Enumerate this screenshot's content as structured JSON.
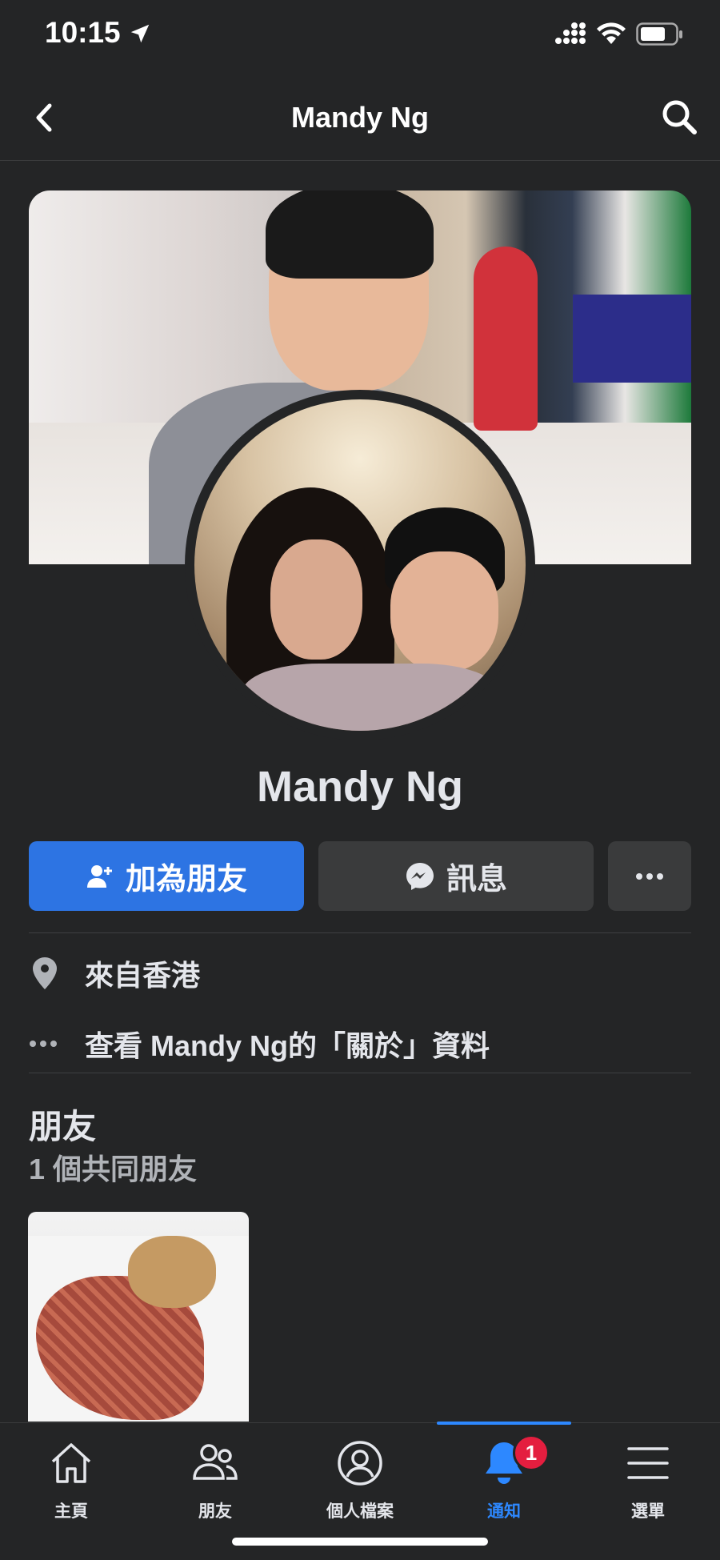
{
  "status": {
    "time": "10:15"
  },
  "nav": {
    "title": "Mandy Ng"
  },
  "profile": {
    "name": "Mandy Ng"
  },
  "actions": {
    "add_friend": "加為朋友",
    "message": "訊息"
  },
  "info": {
    "from": "來自香港",
    "about_link": "查看 Mandy Ng的「關於」資料"
  },
  "friends": {
    "title": "朋友",
    "mutual": "1 個共同朋友"
  },
  "tabbar": {
    "items": [
      {
        "label": "主頁",
        "icon": "home-icon"
      },
      {
        "label": "朋友",
        "icon": "friends-icon"
      },
      {
        "label": "個人檔案",
        "icon": "profile-icon"
      },
      {
        "label": "通知",
        "icon": "bell-icon",
        "active": true,
        "badge": "1"
      },
      {
        "label": "選單",
        "icon": "menu-icon"
      }
    ]
  },
  "colors": {
    "accent": "#2d74e3",
    "background": "#242526",
    "badge": "#e41e3f"
  }
}
